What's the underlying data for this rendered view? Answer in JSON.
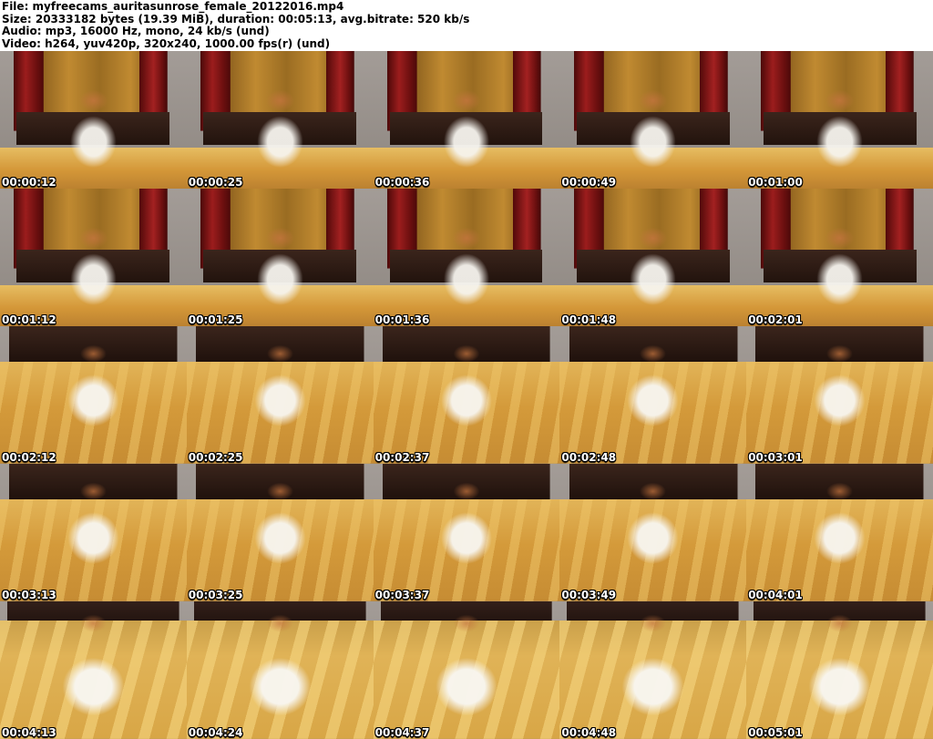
{
  "header": {
    "lines": [
      "File: myfreecams_auritasunrose_female_20122016.mp4",
      "Size: 20333182 bytes (19.39 MiB), duration: 00:05:13, avg.bitrate: 520 kb/s",
      "Audio: mp3, 16000 Hz, mono, 24 kb/s (und)",
      "Video: h264, yuv420p, 320x240, 1000.00 fps(r) (und)"
    ]
  },
  "grid": {
    "columns": 5,
    "rows": 5,
    "frames": [
      {
        "timestamp": "00:00:12",
        "variant": "room"
      },
      {
        "timestamp": "00:00:25",
        "variant": "room"
      },
      {
        "timestamp": "00:00:36",
        "variant": "room"
      },
      {
        "timestamp": "00:00:49",
        "variant": "room"
      },
      {
        "timestamp": "00:01:00",
        "variant": "room"
      },
      {
        "timestamp": "00:01:12",
        "variant": "room"
      },
      {
        "timestamp": "00:01:25",
        "variant": "room"
      },
      {
        "timestamp": "00:01:36",
        "variant": "room"
      },
      {
        "timestamp": "00:01:48",
        "variant": "room"
      },
      {
        "timestamp": "00:02:01",
        "variant": "room"
      },
      {
        "timestamp": "00:02:12",
        "variant": "close"
      },
      {
        "timestamp": "00:02:25",
        "variant": "close"
      },
      {
        "timestamp": "00:02:37",
        "variant": "close"
      },
      {
        "timestamp": "00:02:48",
        "variant": "close"
      },
      {
        "timestamp": "00:03:01",
        "variant": "close"
      },
      {
        "timestamp": "00:03:13",
        "variant": "close"
      },
      {
        "timestamp": "00:03:25",
        "variant": "close"
      },
      {
        "timestamp": "00:03:37",
        "variant": "close"
      },
      {
        "timestamp": "00:03:49",
        "variant": "close"
      },
      {
        "timestamp": "00:04:01",
        "variant": "close"
      },
      {
        "timestamp": "00:04:13",
        "variant": "bright"
      },
      {
        "timestamp": "00:04:24",
        "variant": "bright"
      },
      {
        "timestamp": "00:04:37",
        "variant": "bright"
      },
      {
        "timestamp": "00:04:48",
        "variant": "bright"
      },
      {
        "timestamp": "00:05:01",
        "variant": "bright"
      }
    ]
  },
  "colors": {
    "header_bg": "#ffffff",
    "header_text": "#000000",
    "timestamp_text": "#ffffff",
    "timestamp_outline": "#000000",
    "curtain_red": "#7d1414",
    "drape_gold": "#b8812d",
    "headboard_brown": "#2a1810",
    "bed_gold": "#d49a3a",
    "wall_gray": "#99928d"
  }
}
